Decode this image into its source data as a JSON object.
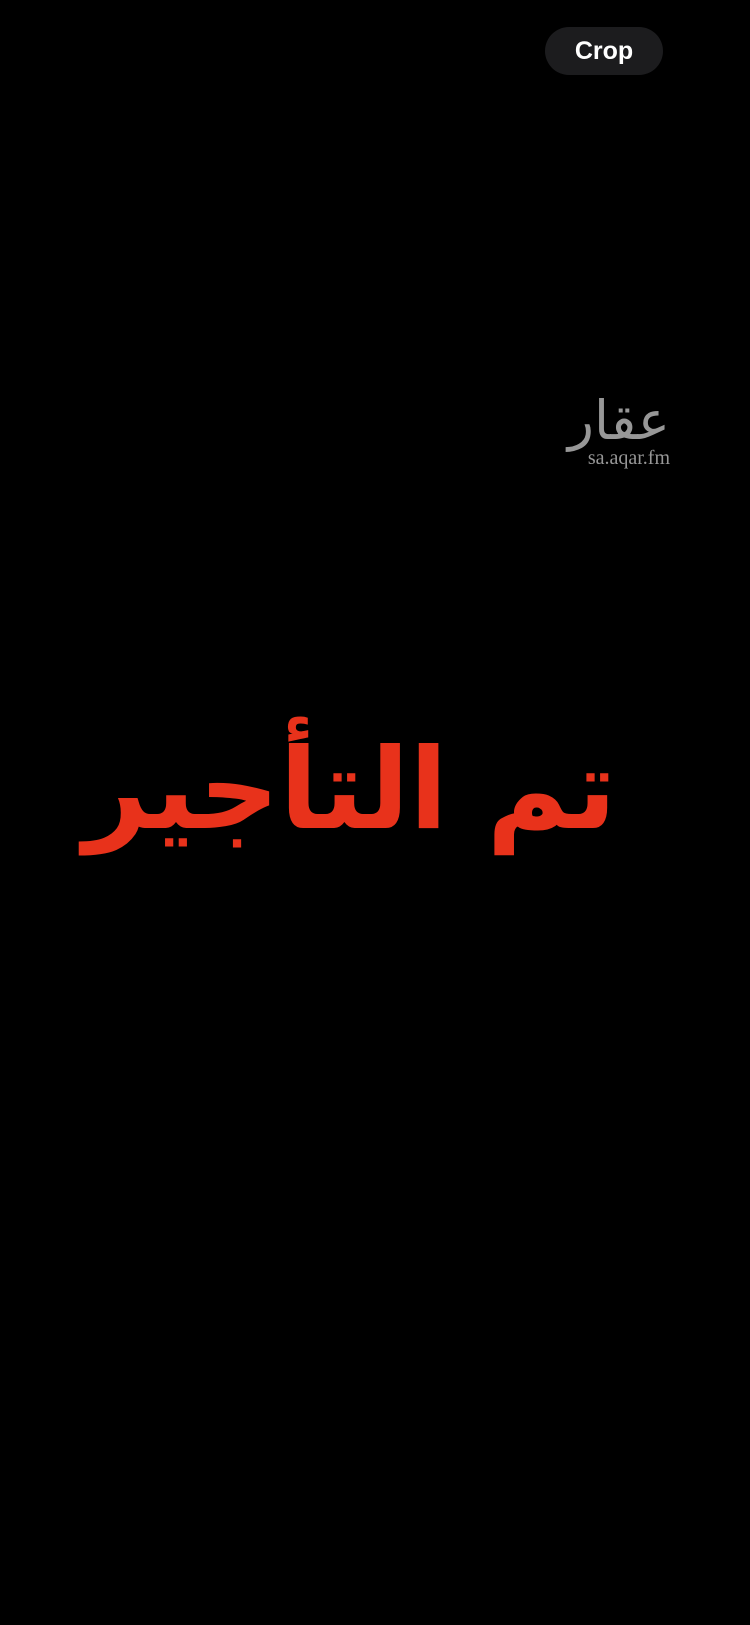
{
  "toolbar": {
    "crop_label": "Crop"
  },
  "watermark": {
    "name": "عقار",
    "url": "sa.aqar.fm"
  },
  "image": {
    "headline": "تم التأجير"
  },
  "colors": {
    "background": "#000000",
    "headline": "#e8321b",
    "watermark": "#a8a8a8",
    "button_bg": "#1c1c1e",
    "button_text": "#ffffff"
  }
}
